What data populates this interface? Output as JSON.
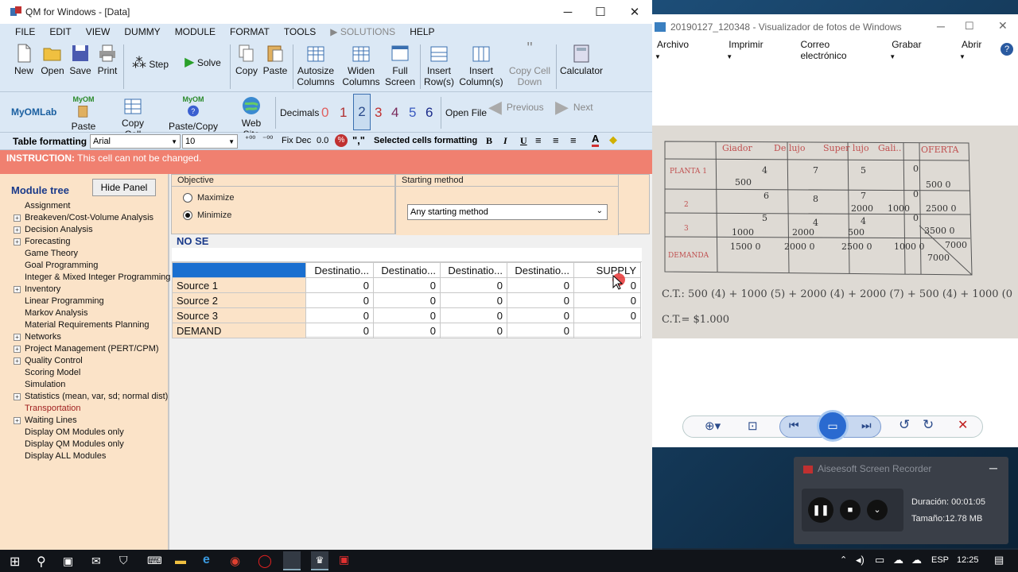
{
  "qm": {
    "title": "QM for Windows - [Data]",
    "menu": [
      "FILE",
      "EDIT",
      "VIEW",
      "DUMMY",
      "MODULE",
      "FORMAT",
      "TOOLS",
      "SOLUTIONS",
      "HELP"
    ],
    "toolbar": {
      "new": "New",
      "open": "Open",
      "save": "Save",
      "print": "Print",
      "step": "Step",
      "solve": "Solve",
      "copy": "Copy",
      "paste": "Paste",
      "autosize": "Autosize Columns",
      "widen": "Widen Columns",
      "fullscreen": "Full Screen",
      "insert_rows": "Insert Row(s)",
      "insert_cols": "Insert Column(s)",
      "copy_cell_down": "Copy Cell Down",
      "calculator": "Calculator"
    },
    "toolbar2": {
      "myomlab": "MyOMLab",
      "myom_badge": "MyOM",
      "paste_from": "Paste From",
      "copy_cell": "Copy Cell",
      "paste_copy_help": "Paste/Copy Help",
      "web_site": "Web Site",
      "decimals": "Decimals",
      "decimal_values": [
        "0",
        "1",
        "2",
        "3",
        "4",
        "5",
        "6"
      ],
      "open_file": "Open File",
      "previous": "Previous",
      "next": "Next"
    },
    "toolbar3": {
      "table_formatting": "Table formatting",
      "font": "Arial",
      "size": "10",
      "fix_dec": "Fix Dec",
      "zero": "0.0",
      "selected_cells": "Selected cells formatting",
      "bold": "B",
      "italic": "I",
      "underline": "U"
    },
    "instruction": {
      "label": "INSTRUCTION:",
      "text": "This cell can not be changed."
    },
    "module_tree": {
      "title": "Module tree",
      "hide_panel": "Hide Panel",
      "items": [
        {
          "label": "Assignment",
          "exp": false
        },
        {
          "label": "Breakeven/Cost-Volume Analysis",
          "exp": true
        },
        {
          "label": "Decision Analysis",
          "exp": true
        },
        {
          "label": "Forecasting",
          "exp": true
        },
        {
          "label": "Game Theory",
          "exp": false
        },
        {
          "label": "Goal Programming",
          "exp": false
        },
        {
          "label": "Integer & Mixed Integer Programming",
          "exp": false
        },
        {
          "label": "Inventory",
          "exp": true
        },
        {
          "label": "Linear Programming",
          "exp": false
        },
        {
          "label": "Markov Analysis",
          "exp": false
        },
        {
          "label": "Material Requirements Planning",
          "exp": false
        },
        {
          "label": "Networks",
          "exp": true
        },
        {
          "label": "Project Management (PERT/CPM)",
          "exp": true
        },
        {
          "label": "Quality Control",
          "exp": true
        },
        {
          "label": "Scoring Model",
          "exp": false
        },
        {
          "label": "Simulation",
          "exp": false
        },
        {
          "label": "Statistics (mean, var, sd; normal dist)",
          "exp": true
        },
        {
          "label": "Transportation",
          "exp": false,
          "sel": true
        },
        {
          "label": "Waiting Lines",
          "exp": true
        },
        {
          "label": "Display OM Modules only",
          "exp": false
        },
        {
          "label": "Display QM Modules only",
          "exp": false
        },
        {
          "label": "Display ALL Modules",
          "exp": false
        }
      ]
    },
    "objective": {
      "title": "Objective",
      "maximize": "Maximize",
      "minimize": "Minimize",
      "selected": "minimize"
    },
    "starting_method": {
      "title": "Starting method",
      "value": "Any starting method"
    },
    "problem_title": "NO SE",
    "table": {
      "headers": [
        "",
        "Destinatio...",
        "Destinatio...",
        "Destinatio...",
        "Destinatio...",
        "SUPPLY"
      ],
      "rows": [
        {
          "label": "Source 1",
          "values": [
            "0",
            "0",
            "0",
            "0",
            "0"
          ]
        },
        {
          "label": "Source 2",
          "values": [
            "0",
            "0",
            "0",
            "0",
            "0"
          ]
        },
        {
          "label": "Source 3",
          "values": [
            "0",
            "0",
            "0",
            "0",
            "0"
          ]
        },
        {
          "label": "DEMAND",
          "values": [
            "0",
            "0",
            "0",
            "0",
            ""
          ]
        }
      ]
    }
  },
  "photo_viewer": {
    "title": "20190127_120348 - Visualizador de fotos de Windows",
    "menu": [
      "Archivo",
      "Imprimir",
      "Correo electrónico",
      "Grabar",
      "Abrir"
    ],
    "photo_headers": [
      "Giador",
      "De lujo",
      "Super lujo",
      "Gali..",
      "OFERTA"
    ],
    "photo_rows": [
      "PLANTA 1",
      "2",
      "3",
      "DEMANDA"
    ],
    "photo_cells": [
      "4",
      "7",
      "5",
      "0",
      "500",
      "500 0",
      "6",
      "8",
      "7",
      "0",
      "2000",
      "1000",
      "2500 0",
      "5",
      "4",
      "4",
      "0",
      "1000",
      "2000",
      "500",
      "3500 0",
      "1500 0",
      "2000 0",
      "2500 0",
      "1000 0",
      "7000",
      "7000"
    ],
    "photo_formula": "C.T.: 500 (4) + 1000 (5) + 2000 (4) + 2000 (7) + 500 (4) + 1000 (0",
    "photo_total": "C.T.= $1.000"
  },
  "recorder": {
    "app": "Aiseesoft Screen Recorder",
    "duration_label": "Duración:",
    "duration": "00:01:05",
    "size_label": "Tamaño:",
    "size": "12.78 MB"
  },
  "taskbar": {
    "lang": "ESP",
    "time": "12:25"
  }
}
